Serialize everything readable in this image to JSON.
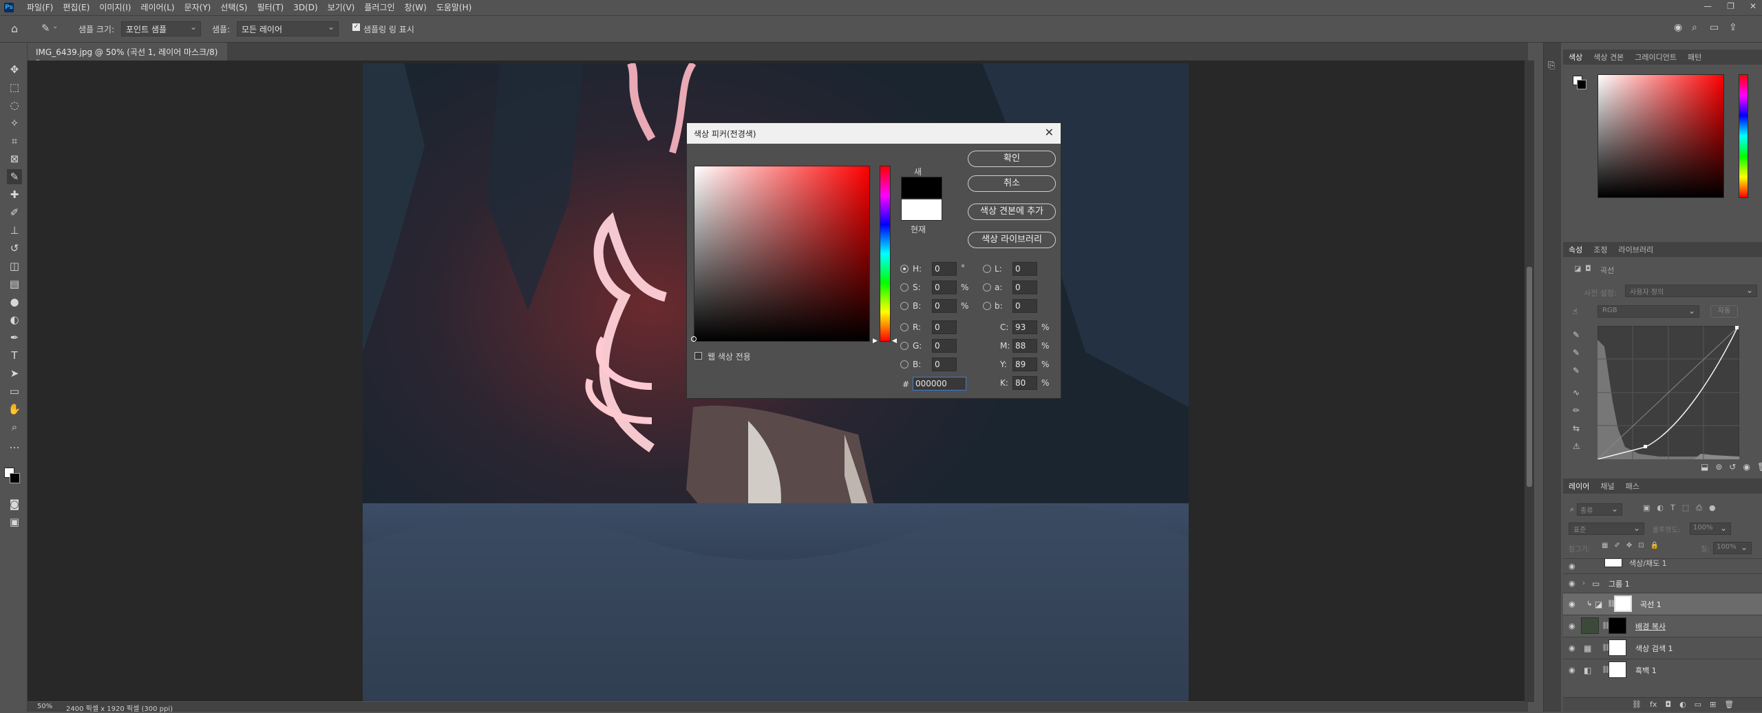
{
  "app": {
    "logo": "Ps"
  },
  "menu": [
    "파일(F)",
    "편집(E)",
    "이미지(I)",
    "레이어(L)",
    "문자(Y)",
    "선택(S)",
    "필터(T)",
    "3D(D)",
    "보기(V)",
    "플러그인",
    "창(W)",
    "도움말(H)"
  ],
  "options": {
    "sample_size_label": "샘플 크기:",
    "sample_size_value": "포인트 샘플",
    "sample_label": "샘플:",
    "sample_value": "모든 레이어",
    "show_ring_label": "샘플링 링 표시"
  },
  "document": {
    "tab_title": "IMG_6439.jpg @ 50% (곡선 1, 레이어 마스크/8) *",
    "zoom": "50%",
    "size_info": "2400 픽셀 x 1920 픽셀 (300 ppi)"
  },
  "color_picker": {
    "title": "색상 피커(전경색)",
    "ok": "확인",
    "cancel": "취소",
    "add_swatch": "색상 견본에 추가",
    "libraries": "색상 라이브러리",
    "new_label": "새",
    "current_label": "현재",
    "web_only": "웹 색상 전용",
    "new_color": "#000000",
    "current_color": "#ffffff",
    "hsb": {
      "H": "0",
      "S": "0",
      "B": "0"
    },
    "rgb": {
      "R": "0",
      "G": "0",
      "B": "0"
    },
    "lab": {
      "L": "0",
      "a": "0",
      "b": "0"
    },
    "cmyk": {
      "C": "93",
      "M": "88",
      "Y": "89",
      "K": "80"
    },
    "hex": "000000",
    "units": {
      "deg": "°",
      "pct": "%"
    }
  },
  "panels": {
    "color_tabs": [
      "색상",
      "색상 견본",
      "그레이디언트",
      "패턴"
    ],
    "props_tabs": [
      "속성",
      "조정",
      "라이브러리"
    ],
    "props_title": "곡선",
    "preset_label": "사전 설정:",
    "preset_value": "사용자 정의",
    "channel": "RGB",
    "auto": "자동",
    "layers_tabs": [
      "레이어",
      "채널",
      "패스"
    ],
    "layer_filter": "종류",
    "blend_mode": "표준",
    "opacity_label": "불투명도:",
    "opacity": "100%",
    "lock_label": "잠그기:",
    "fill_label": "칠:",
    "fill": "100%",
    "layers": [
      "색상/채도 1",
      "그룹 1",
      "곡선 1",
      "배경 복사",
      "색상 검색 1",
      "흑백 1"
    ]
  }
}
